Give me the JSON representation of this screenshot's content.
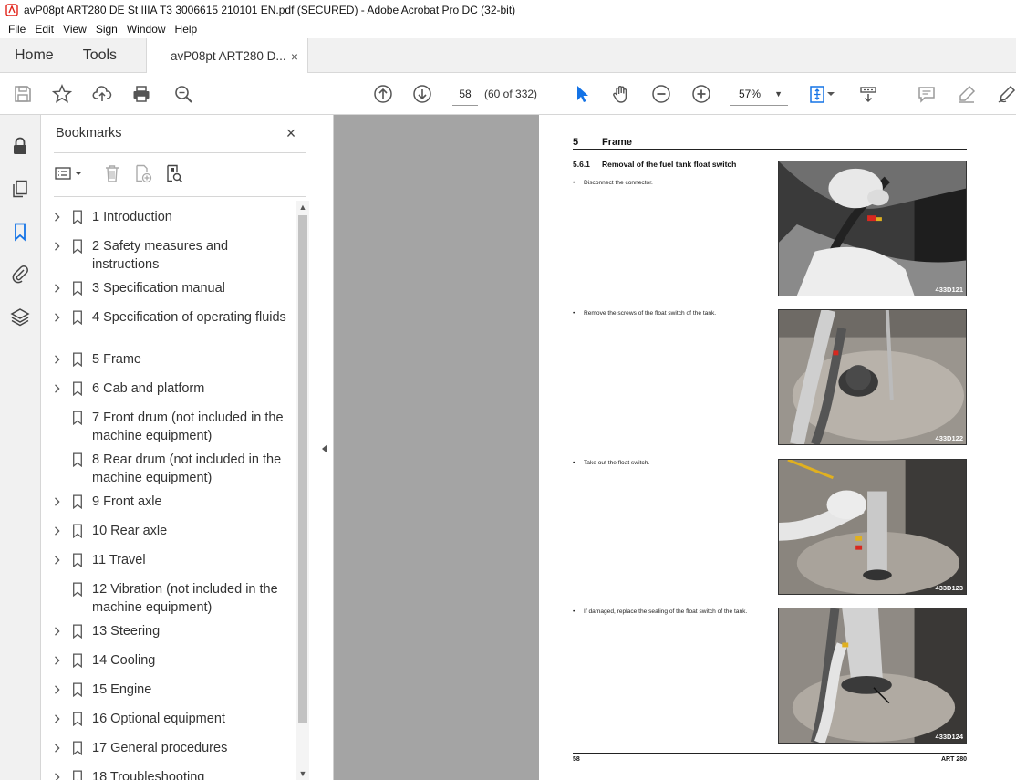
{
  "window": {
    "title": "avP08pt ART280 DE St IIIA T3 3006615 210101 EN.pdf (SECURED) - Adobe Acrobat Pro DC (32-bit)",
    "app_icon": "acrobat-icon",
    "accent_color": "#e2231a"
  },
  "menu": [
    "File",
    "Edit",
    "View",
    "Sign",
    "Window",
    "Help"
  ],
  "tabs": {
    "home": "Home",
    "tools": "Tools",
    "document": "avP08pt ART280 D...",
    "close": "×"
  },
  "toolbar": {
    "current_page": "58",
    "page_of": "(60 of 332)",
    "zoom": "57%",
    "icons": [
      "save-icon",
      "star-icon",
      "upload-icon",
      "print-icon",
      "search-zoom-icon",
      "page-up-icon",
      "page-down-icon",
      "select-cursor-icon",
      "hand-icon",
      "zoom-out-icon",
      "zoom-in-icon",
      "fit-page-icon",
      "scroll-mode-icon",
      "comment-icon",
      "highlight-icon",
      "sign-icon"
    ]
  },
  "rail": {
    "icons": [
      "lock-icon",
      "pages-icon",
      "bookmark-icon",
      "attachment-icon",
      "layers-icon"
    ]
  },
  "bookmarks": {
    "header": "Bookmarks",
    "close": "×",
    "items": [
      {
        "label": "1 Introduction",
        "expandable": true
      },
      {
        "label": "2 Safety measures and instructions",
        "expandable": true
      },
      {
        "label": "3 Specification manual",
        "expandable": true
      },
      {
        "label": "4 Specification of operating fluids",
        "expandable": true
      },
      {
        "label": "5 Frame",
        "expandable": true
      },
      {
        "label": "6 Cab and platform",
        "expandable": true
      },
      {
        "label": "7 Front drum (not included in the machine equipment)",
        "expandable": false
      },
      {
        "label": "8 Rear drum (not included in the machine equipment)",
        "expandable": false
      },
      {
        "label": "9 Front axle",
        "expandable": true
      },
      {
        "label": "10 Rear axle",
        "expandable": true
      },
      {
        "label": "11 Travel",
        "expandable": true
      },
      {
        "label": "12 Vibration (not included in the machine equipment)",
        "expandable": false
      },
      {
        "label": "13 Steering",
        "expandable": true
      },
      {
        "label": "14 Cooling",
        "expandable": true
      },
      {
        "label": "15 Engine",
        "expandable": true
      },
      {
        "label": "16 Optional equipment",
        "expandable": true
      },
      {
        "label": "17 General procedures",
        "expandable": true
      },
      {
        "label": "18 Troubleshooting",
        "expandable": true
      }
    ]
  },
  "page": {
    "heading_num": "5",
    "heading": "Frame",
    "sub_num": "5.6.1",
    "sub": "Removal of the fuel tank float switch",
    "steps": [
      {
        "bullet": "•",
        "text": "Disconnect the connector.",
        "photo": "433D121"
      },
      {
        "bullet": "•",
        "text": "Remove the screws of the float switch of the tank.",
        "photo": "433D122"
      },
      {
        "bullet": "•",
        "text": "Take out the float switch.",
        "photo": "433D123"
      },
      {
        "bullet": "•",
        "text": "If damaged, replace the sealing of the float switch of the tank.",
        "photo": "433D124"
      }
    ],
    "footer_left": "58",
    "footer_right": "ART 280"
  }
}
